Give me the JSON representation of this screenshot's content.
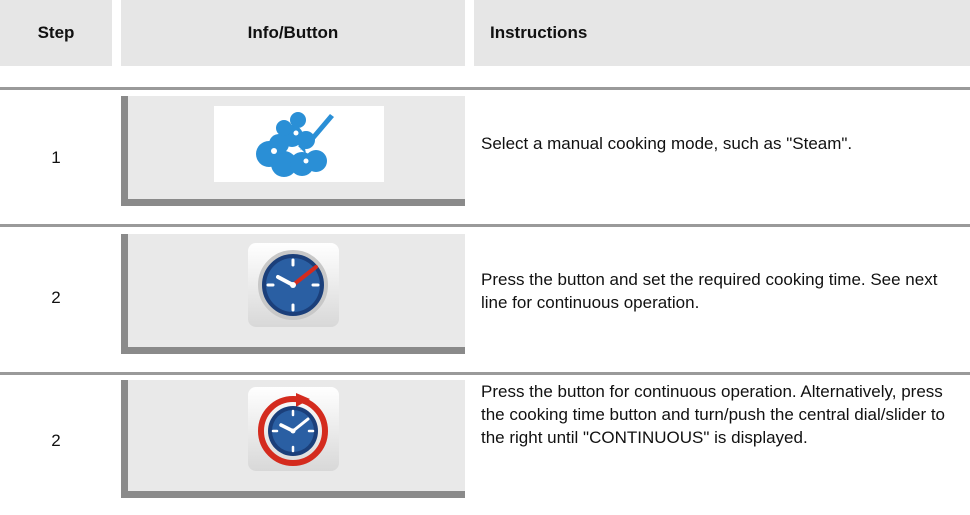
{
  "header": {
    "step": "Step",
    "info": "Info/Button",
    "instructions": "Instructions"
  },
  "rows": [
    {
      "step": "1",
      "icon": "steam-cooking-mode-icon",
      "instruction": "Select a manual cooking mode, such as \"Steam\"."
    },
    {
      "step": "2",
      "icon": "clock-cooking-time-icon",
      "instruction": "Press the button and set the required cooking time. See next line for continuous operation."
    },
    {
      "step": "2",
      "icon": "continuous-operation-clock-icon",
      "instruction": "Press the button for continuous operation. Alternatively, press the cooking time button and turn/push the central dial/slider to the right until \"CONTINUOUS\" is displayed."
    }
  ],
  "colors": {
    "header_bg": "#e6e6e6",
    "panel_bg": "#e9e9e9",
    "panel_border": "#8a8a8a",
    "steam_blue": "#2a8fd6",
    "clock_navy": "#1b3f7a",
    "clock_hand_red": "#d42b1e"
  }
}
